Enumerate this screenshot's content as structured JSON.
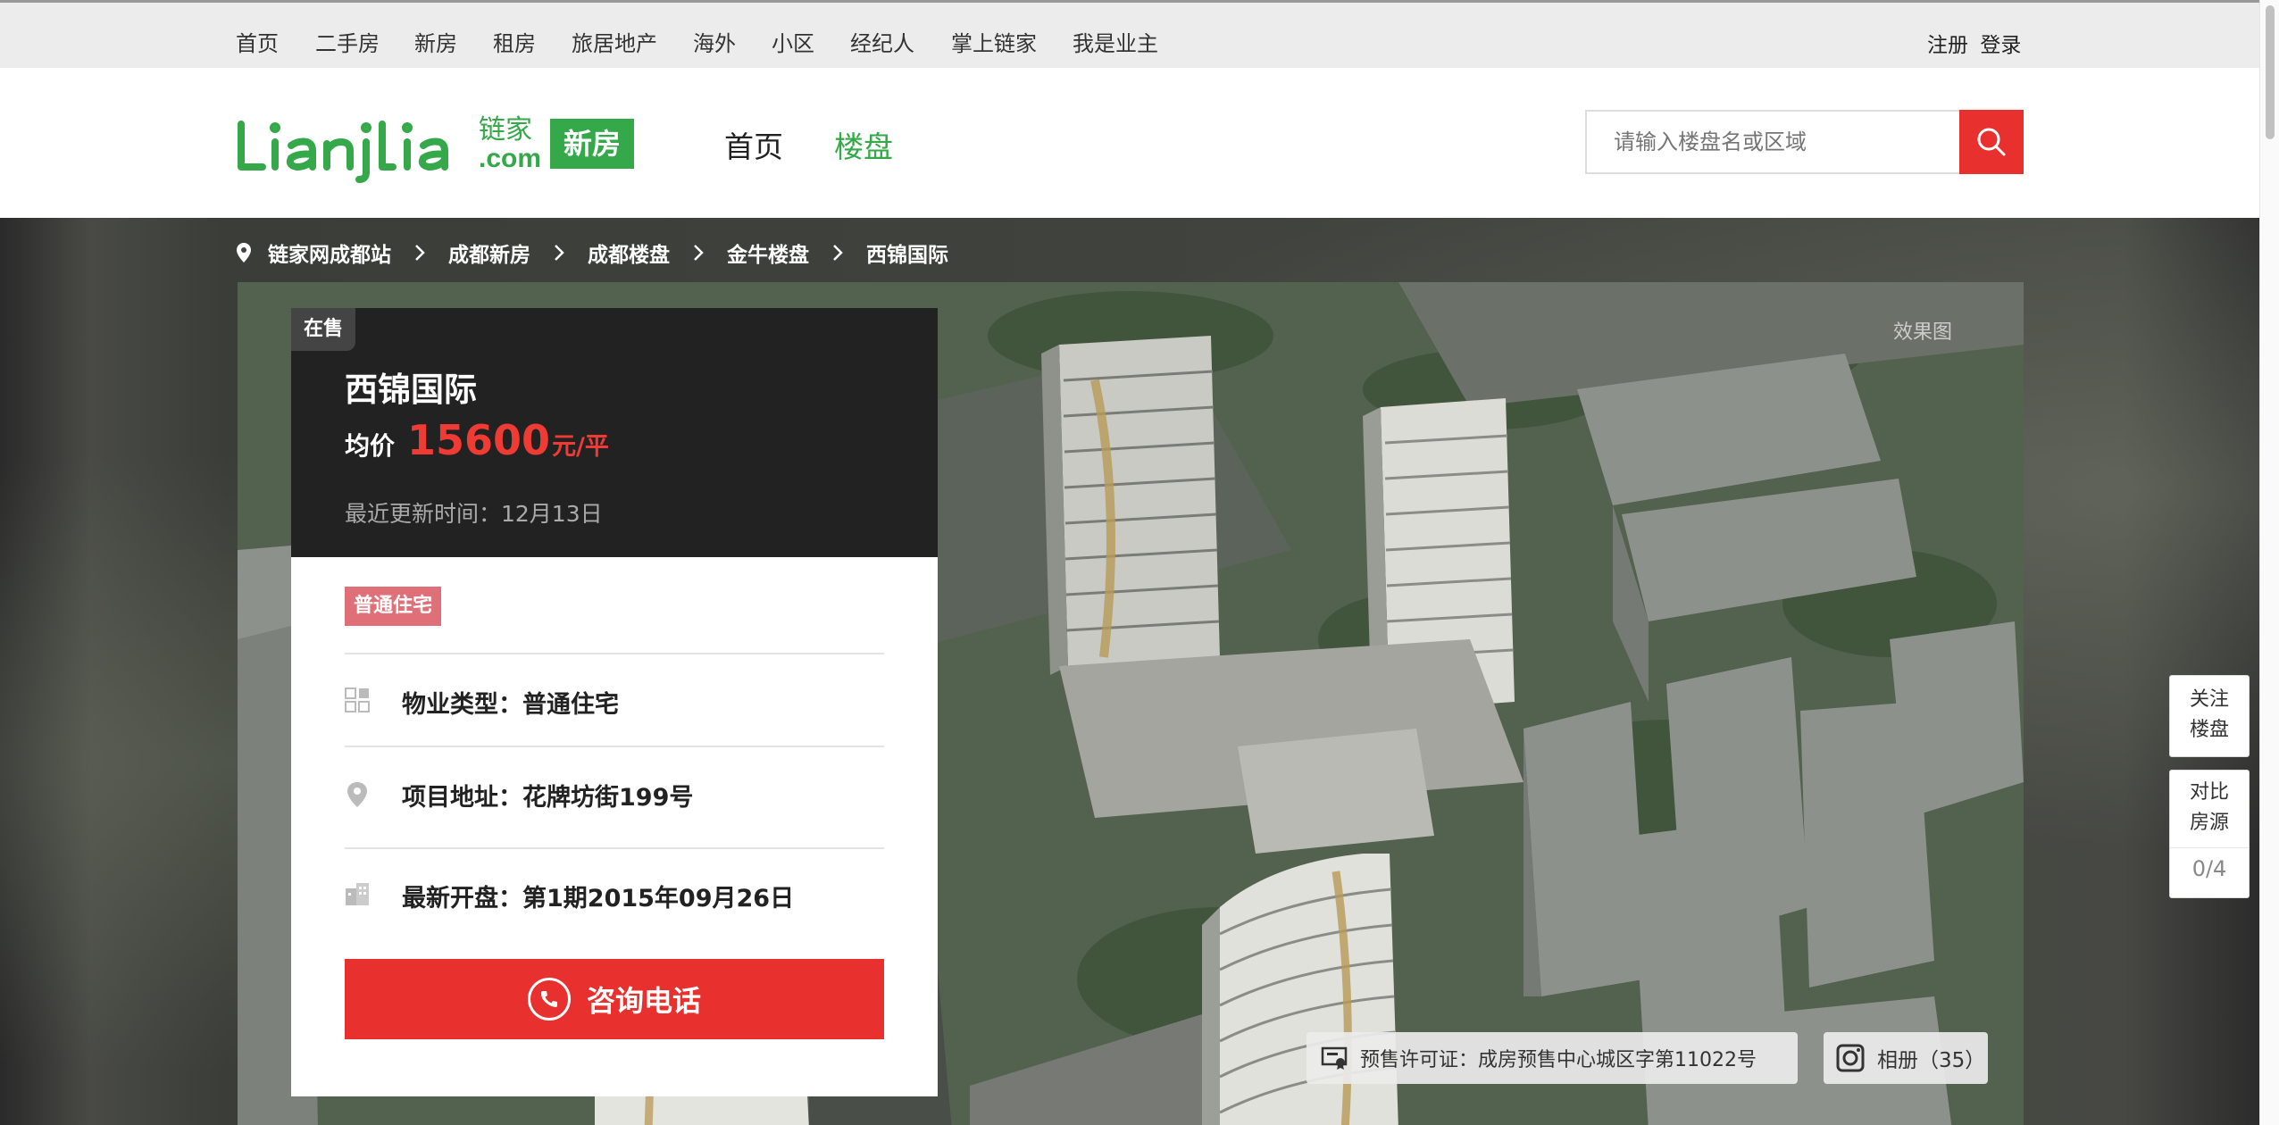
{
  "topnav": {
    "items": [
      "首页",
      "二手房",
      "新房",
      "租房",
      "旅居地产",
      "海外",
      "小区",
      "经纪人",
      "掌上链家",
      "我是业主"
    ],
    "register": "注册",
    "login": "登录"
  },
  "header": {
    "logo_text": "Lianjia",
    "logo_cn": "链家",
    "logo_com": ".com",
    "badge": "新房",
    "nav_home": "首页",
    "nav_loupan": "楼盘",
    "search_placeholder": "请输入楼盘名或区域",
    "accent_color": "#35a94a",
    "search_btn_color": "#e8302e"
  },
  "breadcrumb": [
    "链家网成都站",
    "成都新房",
    "成都楼盘",
    "金牛楼盘",
    "西锦国际"
  ],
  "photo": {
    "label": "效果图"
  },
  "property": {
    "status": "在售",
    "name": "西锦国际",
    "price_label": "均价",
    "price": "15600",
    "price_unit": "元/平",
    "update_label": "最近更新时间：12月13日",
    "tag": "普通住宅",
    "type_text": "物业类型：普通住宅",
    "address_text": "项目地址：花牌坊街199号",
    "opening_text": "最新开盘：第1期2015年09月26日",
    "call_label": "咨询电话",
    "price_color": "#f03b34"
  },
  "permit": {
    "text": "预售许可证：成房预售中心城区字第11022号"
  },
  "album": {
    "label": "相册（35）"
  },
  "float": {
    "follow_line1": "关注",
    "follow_line2": "楼盘",
    "compare_line1": "对比",
    "compare_line2": "房源",
    "compare_count": "0/4"
  }
}
